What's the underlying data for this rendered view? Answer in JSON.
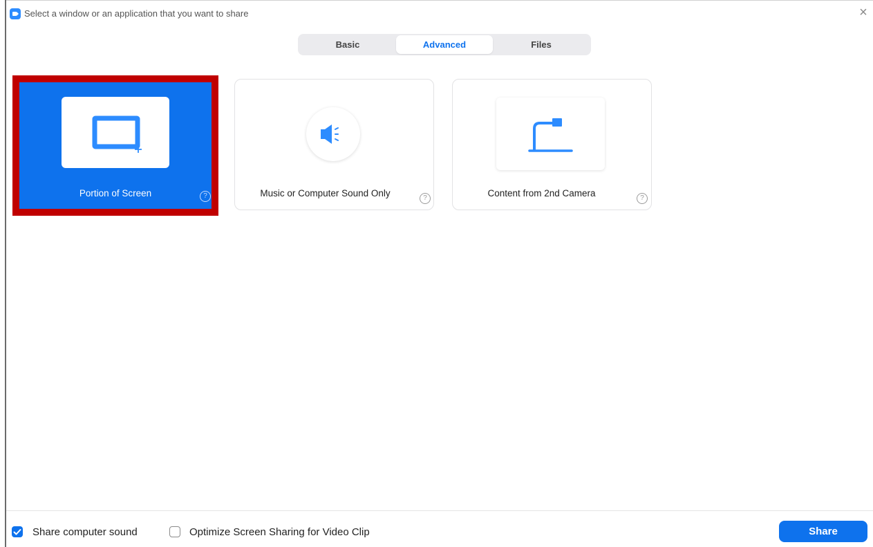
{
  "window": {
    "title": "Select a window or an application that you want to share",
    "close_glyph": "×",
    "app_icon": "zoom-camera-icon"
  },
  "tabs": [
    {
      "label": "Basic",
      "active": false
    },
    {
      "label": "Advanced",
      "active": true
    },
    {
      "label": "Files",
      "active": false
    }
  ],
  "options": [
    {
      "label": "Portion of Screen",
      "icon": "portion-of-screen-icon",
      "selected": true,
      "help": "?"
    },
    {
      "label": "Music or Computer Sound Only",
      "icon": "speaker-icon",
      "selected": false,
      "help": "?"
    },
    {
      "label": "Content from 2nd Camera",
      "icon": "document-camera-icon",
      "selected": false,
      "help": "?"
    }
  ],
  "footer": {
    "share_sound_label": "Share computer sound",
    "share_sound_checked": true,
    "optimize_label": "Optimize Screen Sharing for Video Clip",
    "optimize_checked": false,
    "share_button": "Share"
  },
  "colors": {
    "accent": "#0e72ed",
    "selection_border": "#c00000",
    "tab_bg": "#ebebee"
  }
}
